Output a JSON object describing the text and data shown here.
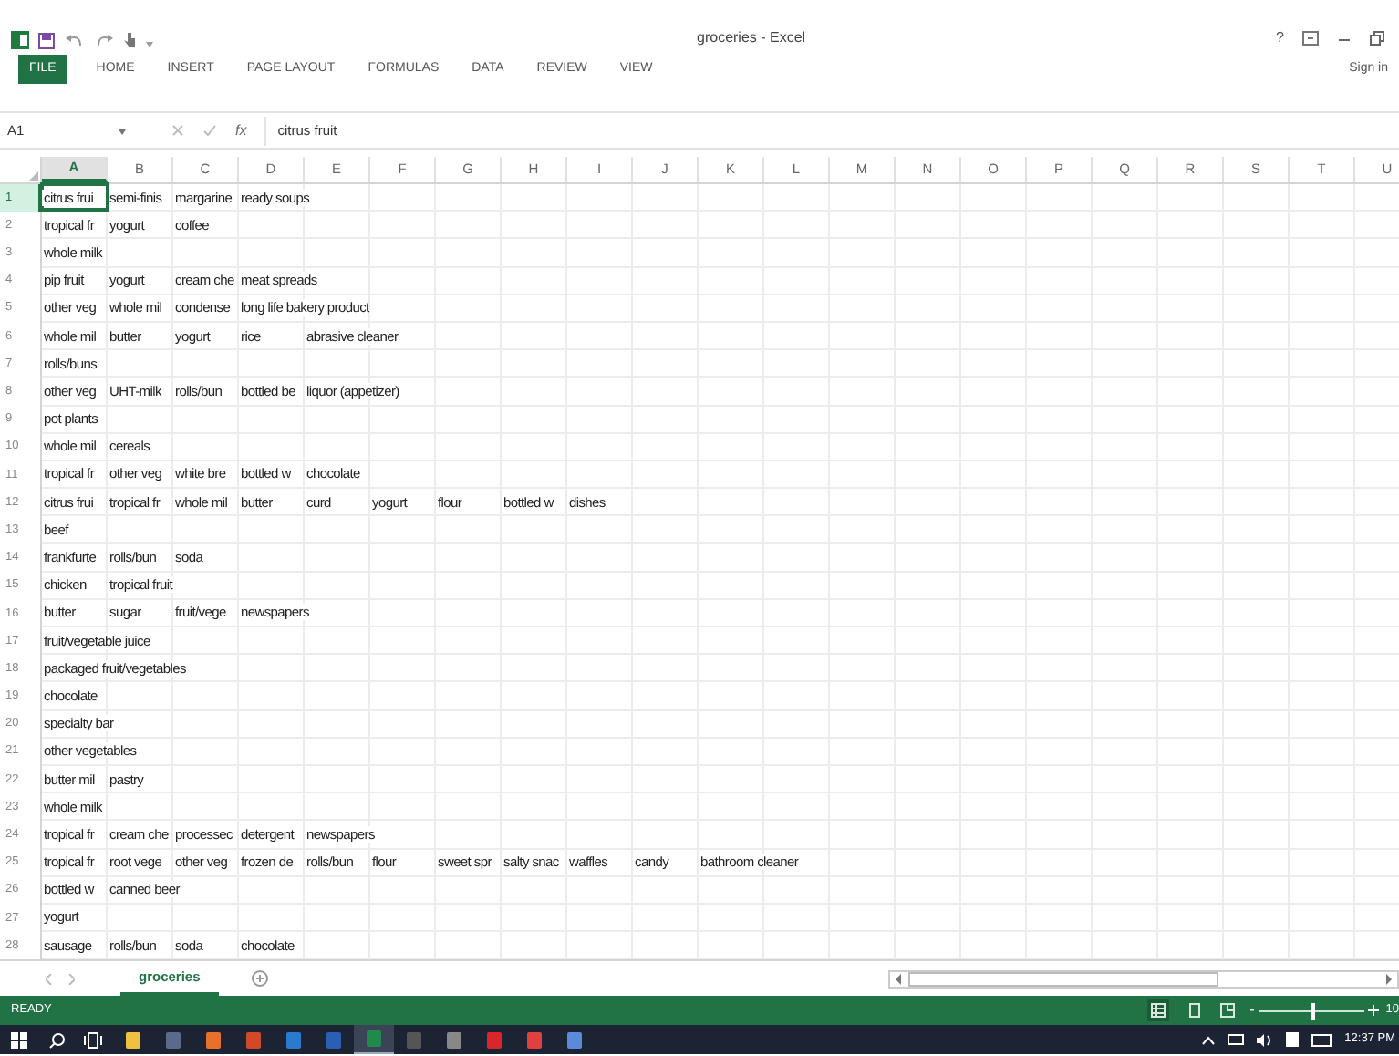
{
  "window": {
    "title": "groceries - Excel",
    "help": "?",
    "sign_in": "Sign in"
  },
  "ribbon_tabs": [
    {
      "label": "FILE",
      "kind": "file"
    },
    {
      "label": "HOME",
      "kind": "tab"
    },
    {
      "label": "INSERT",
      "kind": "tab"
    },
    {
      "label": "PAGE LAYOUT",
      "kind": "tab"
    },
    {
      "label": "FORMULAS",
      "kind": "tab"
    },
    {
      "label": "DATA",
      "kind": "tab"
    },
    {
      "label": "REVIEW",
      "kind": "tab"
    },
    {
      "label": "VIEW",
      "kind": "tab"
    }
  ],
  "formula_bar": {
    "name_box": "A1",
    "fx": "fx",
    "value": "citrus fruit"
  },
  "columns": [
    {
      "label": "A",
      "selected": true
    },
    {
      "label": "B",
      "selected": false
    },
    {
      "label": "C",
      "selected": false
    },
    {
      "label": "D",
      "selected": false
    },
    {
      "label": "E",
      "selected": false
    },
    {
      "label": "F",
      "selected": false
    },
    {
      "label": "G",
      "selected": false
    },
    {
      "label": "H",
      "selected": false
    },
    {
      "label": "I",
      "selected": false
    },
    {
      "label": "J",
      "selected": false
    },
    {
      "label": "K",
      "selected": false
    },
    {
      "label": "L",
      "selected": false
    },
    {
      "label": "M",
      "selected": false
    },
    {
      "label": "N",
      "selected": false
    },
    {
      "label": "O",
      "selected": false
    },
    {
      "label": "P",
      "selected": false
    },
    {
      "label": "Q",
      "selected": false
    },
    {
      "label": "R",
      "selected": false
    },
    {
      "label": "S",
      "selected": false
    },
    {
      "label": "T",
      "selected": false
    },
    {
      "label": "U",
      "selected": false
    }
  ],
  "rows": [
    {
      "number": "1",
      "selected": true,
      "cells": [
        "citrus frui",
        "semi-finis",
        "margarine",
        "ready soups"
      ]
    },
    {
      "number": "2",
      "selected": false,
      "cells": [
        "tropical fr",
        "yogurt",
        "coffee"
      ]
    },
    {
      "number": "3",
      "selected": false,
      "cells": [
        "whole milk"
      ]
    },
    {
      "number": "4",
      "selected": false,
      "cells": [
        "pip fruit",
        "yogurt",
        "cream che",
        "meat spreads"
      ]
    },
    {
      "number": "5",
      "selected": false,
      "cells": [
        "other veg",
        "whole mil",
        "condense",
        "long life bakery product"
      ]
    },
    {
      "number": "6",
      "selected": false,
      "cells": [
        "whole mil",
        "butter",
        "yogurt",
        "rice",
        "abrasive cleaner"
      ]
    },
    {
      "number": "7",
      "selected": false,
      "cells": [
        "rolls/buns"
      ]
    },
    {
      "number": "8",
      "selected": false,
      "cells": [
        "other veg",
        "UHT-milk",
        "rolls/bun",
        "bottled be",
        "liquor (appetizer)"
      ]
    },
    {
      "number": "9",
      "selected": false,
      "cells": [
        "pot plants"
      ]
    },
    {
      "number": "10",
      "selected": false,
      "cells": [
        "whole mil",
        "cereals"
      ]
    },
    {
      "number": "11",
      "selected": false,
      "cells": [
        "tropical fr",
        "other veg",
        "white bre",
        "bottled w",
        "chocolate"
      ]
    },
    {
      "number": "12",
      "selected": false,
      "cells": [
        "citrus frui",
        "tropical fr",
        "whole mil",
        "butter",
        "curd",
        "yogurt",
        "flour",
        "bottled w",
        "dishes"
      ]
    },
    {
      "number": "13",
      "selected": false,
      "cells": [
        "beef"
      ]
    },
    {
      "number": "14",
      "selected": false,
      "cells": [
        "frankfurte",
        "rolls/bun",
        "soda"
      ]
    },
    {
      "number": "15",
      "selected": false,
      "cells": [
        "chicken",
        "tropical fruit"
      ]
    },
    {
      "number": "16",
      "selected": false,
      "cells": [
        "butter",
        "sugar",
        "fruit/vege",
        "newspapers"
      ]
    },
    {
      "number": "17",
      "selected": false,
      "cells": [
        "fruit/vegetable juice"
      ]
    },
    {
      "number": "18",
      "selected": false,
      "cells": [
        "packaged fruit/vegetables"
      ]
    },
    {
      "number": "19",
      "selected": false,
      "cells": [
        "chocolate"
      ]
    },
    {
      "number": "20",
      "selected": false,
      "cells": [
        "specialty bar"
      ]
    },
    {
      "number": "21",
      "selected": false,
      "cells": [
        "other vegetables"
      ]
    },
    {
      "number": "22",
      "selected": false,
      "cells": [
        "butter mil",
        "pastry"
      ]
    },
    {
      "number": "23",
      "selected": false,
      "cells": [
        "whole milk"
      ]
    },
    {
      "number": "24",
      "selected": false,
      "cells": [
        "tropical fr",
        "cream che",
        "processec",
        "detergent",
        "newspapers"
      ]
    },
    {
      "number": "25",
      "selected": false,
      "cells": [
        "tropical fr",
        "root vege",
        "other veg",
        "frozen de",
        "rolls/bun",
        "flour",
        "sweet spr",
        "salty snac",
        "waffles",
        "candy",
        "bathroom cleaner"
      ]
    },
    {
      "number": "26",
      "selected": false,
      "cells": [
        "bottled w",
        "canned beer"
      ]
    },
    {
      "number": "27",
      "selected": false,
      "cells": [
        "yogurt"
      ]
    },
    {
      "number": "28",
      "selected": false,
      "cells": [
        "sausage",
        "rolls/bun",
        "soda",
        "chocolate"
      ]
    }
  ],
  "sheet_tabs": [
    {
      "label": "groceries",
      "selected": true
    }
  ],
  "status_bar": {
    "mode": "READY",
    "zoom_out": "-",
    "zoom": {
      "level": 0.5
    },
    "zoom_text": "10"
  },
  "taskbar": {
    "apps": [
      {
        "color": "#f0c040",
        "selected": false
      },
      {
        "color": "#5a6a8a",
        "selected": false
      },
      {
        "color": "#e8702a",
        "selected": false
      },
      {
        "color": "#d04a2a",
        "selected": false
      },
      {
        "color": "#2a7ad0",
        "selected": false
      },
      {
        "color": "#2b5fb4",
        "selected": false
      },
      {
        "color": "#1f8a4c",
        "selected": true
      },
      {
        "color": "#555555",
        "selected": false
      },
      {
        "color": "#888888",
        "selected": false
      },
      {
        "color": "#d9262b",
        "selected": false
      },
      {
        "color": "#e04040",
        "selected": false
      },
      {
        "color": "#5a8ad8",
        "selected": false
      }
    ],
    "time": "12:37 PM"
  }
}
